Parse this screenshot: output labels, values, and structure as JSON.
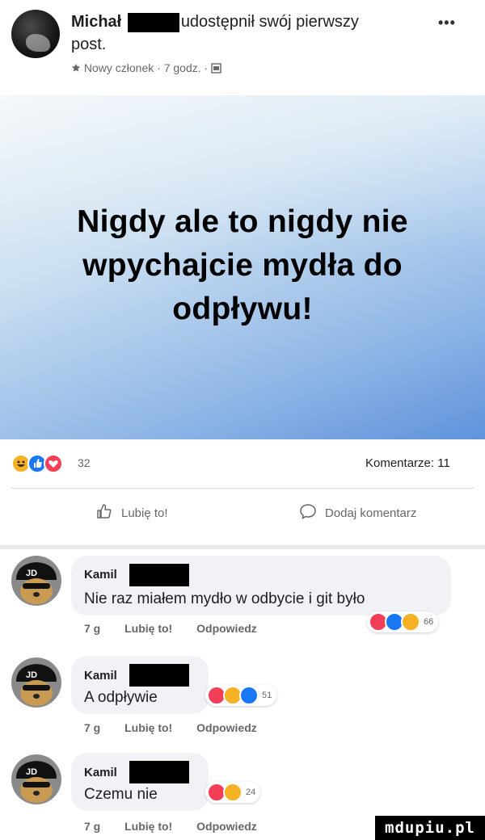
{
  "header": {
    "name": "Michał",
    "action_text": "udostępnił swój pierwszy",
    "action_text_2": "post.",
    "meta_badge": "Nowy członek",
    "meta_time": "7 godz.",
    "more_icon": "more-dots-icon"
  },
  "post": {
    "text": "Nigdy ale to nigdy nie wpychajcie mydła do odpływu!",
    "text_line1": "Nigdy ale to nigdy nie",
    "text_line2": "wpychajcie mydła do",
    "text_line3": "odpływu!"
  },
  "stats": {
    "reaction_icons": [
      "haha-icon",
      "like-icon",
      "love-icon"
    ],
    "reaction_count": "32",
    "comments_label": "Komentarze: 11"
  },
  "actions": {
    "like_label": "Lubię to!",
    "comment_label": "Dodaj komentarz"
  },
  "comments": [
    {
      "name": "Kamil",
      "text": "Nie raz miałem mydło w odbycie i git było",
      "time": "7 g",
      "like_label": "Lubię to!",
      "reply_label": "Odpowiedz",
      "reactions": [
        "love-icon",
        "like-icon",
        "haha-icon"
      ],
      "reaction_count": "66"
    },
    {
      "name": "Kamil",
      "text": "A odpływie",
      "time": "7 g",
      "like_label": "Lubię to!",
      "reply_label": "Odpowiedz",
      "reactions": [
        "love-icon",
        "haha-icon",
        "like-icon"
      ],
      "reaction_count": "51"
    },
    {
      "name": "Kamil",
      "text": "Czemu nie",
      "time": "7 g",
      "like_label": "Lubię to!",
      "reply_label": "Odpowiedz",
      "reactions": [
        "love-icon",
        "haha-icon"
      ],
      "reaction_count": "24"
    }
  ],
  "watermark": "mdupiu.pl",
  "colors": {
    "like": "#1877f2",
    "love": "#f33e58",
    "haha": "#f7b125",
    "meta_text": "#65676b",
    "bubble": "#f0f2f5"
  }
}
